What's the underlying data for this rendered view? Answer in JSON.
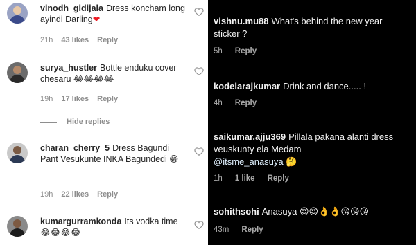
{
  "left_comments": [
    {
      "username": "vinodh_gidijala",
      "text": "Dress koncham long ayindi Darling",
      "emoji": "❤",
      "time": "21h",
      "likes": "43 likes",
      "reply": "Reply"
    },
    {
      "username": "surya_hustler",
      "text": "Bottle enduku cover chesaru",
      "emoji": "😂😂😂😂",
      "time": "19h",
      "likes": "17 likes",
      "reply": "Reply"
    },
    {
      "username": "charan_cherry_5",
      "text": "Dress Bagundi Pant Vesukunte INKA Bagundedi",
      "emoji": "😁",
      "time": "19h",
      "likes": "22 likes",
      "reply": "Reply"
    },
    {
      "username": "kumargurramkonda",
      "text": "Its vodka time",
      "emoji": "😂😂😂😂",
      "time": "",
      "likes": "",
      "reply": ""
    }
  ],
  "hide_replies_label": "Hide replies",
  "right_comments": [
    {
      "username": "vishnu.mu88",
      "text": "What's behind the new year sticker ?",
      "mention": "",
      "emoji": "",
      "time": "5h",
      "likes": "",
      "reply": "Reply"
    },
    {
      "username": "kodelarajkumar",
      "text": "Drink and dance..... !",
      "mention": "",
      "emoji": "",
      "time": "4h",
      "likes": "",
      "reply": "Reply"
    },
    {
      "username": "saikumar.ajju369",
      "text": "Pillala pakana alanti dress veuskunty ela Medam",
      "mention": "@itsme_anasuya",
      "emoji": "🤔",
      "time": "1h",
      "likes": "1 like",
      "reply": "Reply"
    },
    {
      "username": "sohithsohi",
      "text": "Anasuya",
      "mention": "",
      "emoji": "😍😍👌👌😘😘😘",
      "time": "43m",
      "likes": "",
      "reply": "Reply"
    }
  ],
  "colors": {
    "left_bg": "#ffffff",
    "right_bg": "#000000",
    "heart_red": "#ed1c24",
    "muted_text": "#8e8e8e"
  }
}
